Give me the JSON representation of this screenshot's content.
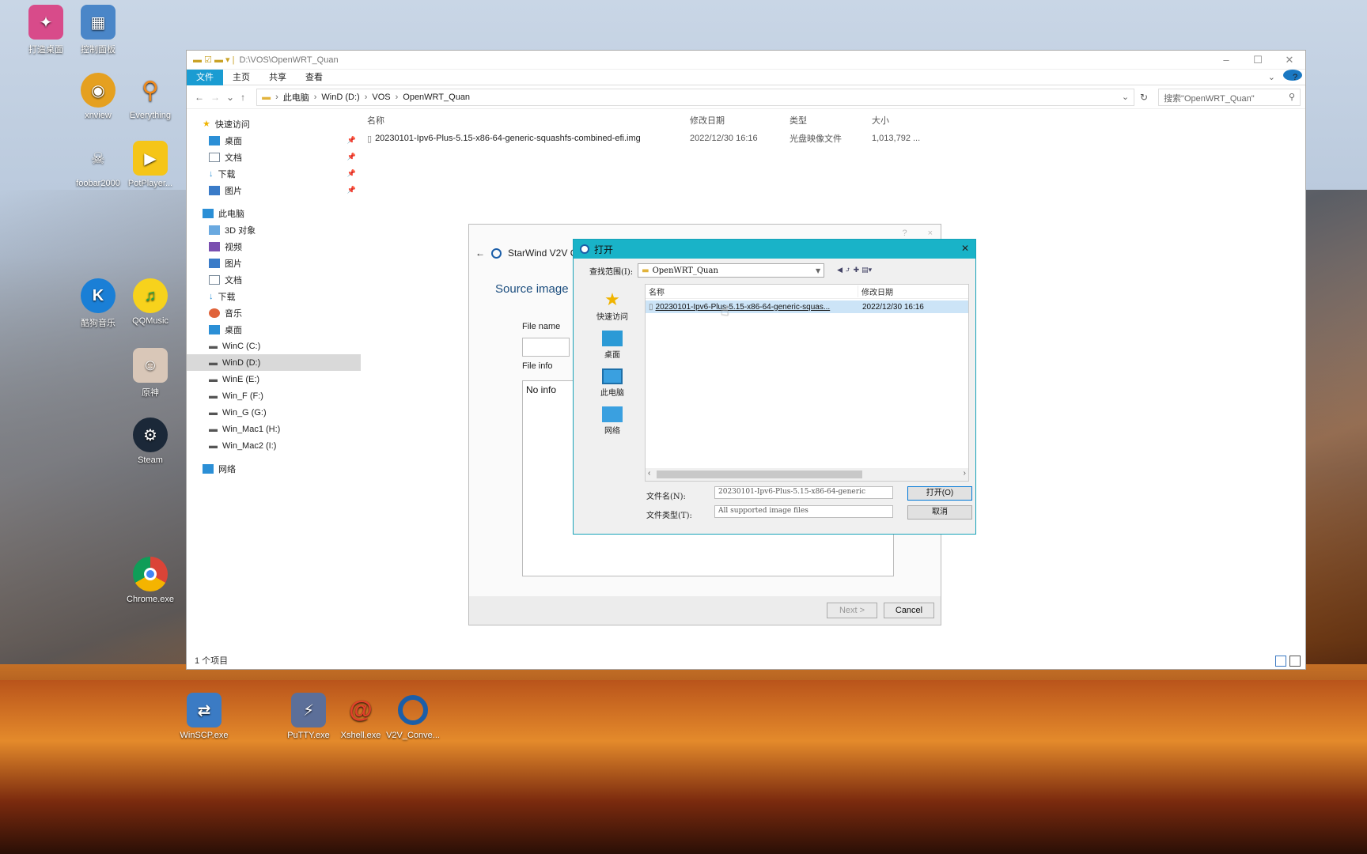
{
  "desktop": {
    "icons": [
      {
        "label": "打造桌面",
        "name": "icon-a"
      },
      {
        "label": "控制面板",
        "name": "icon-b"
      },
      {
        "label": "xnview",
        "name": "xnview"
      },
      {
        "label": "Everything",
        "name": "everything"
      },
      {
        "label": "foobar2000",
        "name": "foobar2000"
      },
      {
        "label": "PotPlayer...",
        "name": "potplayer"
      },
      {
        "label": "酷狗音乐",
        "name": "kugou"
      },
      {
        "label": "QQMusic",
        "name": "qqmusic"
      },
      {
        "label": "原神",
        "name": "genshin"
      },
      {
        "label": "Steam",
        "name": "steam"
      },
      {
        "label": "Chrome.exe",
        "name": "chrome"
      },
      {
        "label": "WinSCP.exe",
        "name": "winscp"
      },
      {
        "label": "PuTTY.exe",
        "name": "putty"
      },
      {
        "label": "Xshell.exe",
        "name": "xshell"
      },
      {
        "label": "V2V_Conve...",
        "name": "v2v-converter"
      }
    ]
  },
  "explorer": {
    "path_title": "D:\\VOS\\OpenWRT_Quan",
    "ribbon": {
      "file": "文件",
      "home": "主页",
      "share": "共享",
      "view": "查看"
    },
    "breadcrumb": [
      "此电脑",
      "WinD (D:)",
      "VOS",
      "OpenWRT_Quan"
    ],
    "search_placeholder": "搜索\"OpenWRT_Quan\"",
    "nav": {
      "quick_access": "快速访问",
      "quick_items": [
        "桌面",
        "文档",
        "下载",
        "图片"
      ],
      "this_pc": "此电脑",
      "pc_items": [
        "3D 对象",
        "视频",
        "图片",
        "文档",
        "下载",
        "音乐",
        "桌面"
      ],
      "drives": [
        "WinC (C:)",
        "WinD (D:)",
        "WinE (E:)",
        "Win_F (F:)",
        "Win_G (G:)",
        "Win_Mac1 (H:)",
        "Win_Mac2 (I:)"
      ],
      "network": "网络"
    },
    "columns": {
      "name": "名称",
      "date": "修改日期",
      "type": "类型",
      "size": "大小"
    },
    "file": {
      "name": "20230101-Ipv6-Plus-5.15-x86-64-generic-squashfs-combined-efi.img",
      "date": "2022/12/30 16:16",
      "type": "光盘映像文件",
      "size": "1,013,792 ..."
    },
    "status": "1 个项目"
  },
  "starwind": {
    "title": "StarWind V2V Co",
    "help": "?",
    "close": "×",
    "heading": "Source image",
    "file_name_label": "File name",
    "file_info_label": "File info",
    "file_info_value": "No info",
    "next": "Next >",
    "cancel": "Cancel"
  },
  "open_dialog": {
    "title": "打开",
    "lookin_label": "查找范围(I):",
    "lookin_value": "OpenWRT_Quan",
    "places": [
      "快速访问",
      "桌面",
      "此电脑",
      "网络"
    ],
    "columns": {
      "name": "名称",
      "date": "修改日期"
    },
    "file": {
      "name": "20230101-Ipv6-Plus-5.15-x86-64-generic-squas...",
      "date": "2022/12/30 16:16"
    },
    "filename_label": "文件名(N):",
    "filename_value": "20230101-Ipv6-Plus-5.15-x86-64-generic",
    "filetype_label": "文件类型(T):",
    "filetype_value": "All supported image files",
    "open_btn": "打开(O)",
    "cancel_btn": "取消"
  }
}
